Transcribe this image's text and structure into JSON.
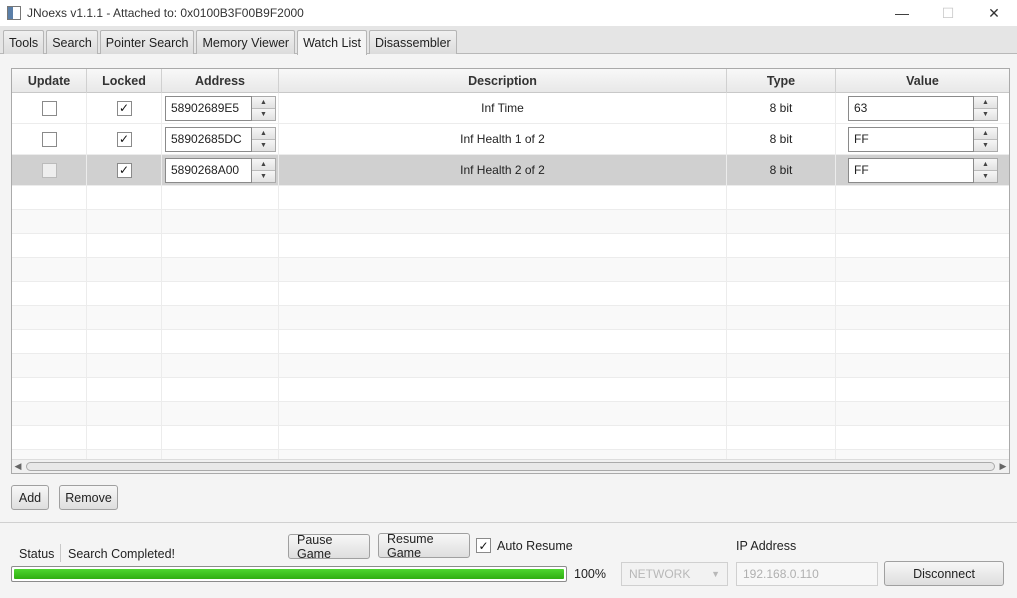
{
  "window": {
    "title": "JNoexs v1.1.1 - Attached to: 0x0100B3F00B9F2000",
    "minimize_glyph": "—",
    "maximize_glyph": "☐",
    "close_glyph": "✕"
  },
  "tabs": [
    {
      "label": "Tools"
    },
    {
      "label": "Search"
    },
    {
      "label": "Pointer Search"
    },
    {
      "label": "Memory Viewer"
    },
    {
      "label": "Watch List",
      "active": true
    },
    {
      "label": "Disassembler"
    }
  ],
  "table": {
    "headers": {
      "update": "Update",
      "locked": "Locked",
      "address": "Address",
      "description": "Description",
      "type": "Type",
      "value": "Value"
    },
    "rows": [
      {
        "update": false,
        "locked": true,
        "address": "58902689E5",
        "description": "Inf Time",
        "type": "8 bit",
        "value": "63",
        "selected": false
      },
      {
        "update": false,
        "locked": true,
        "address": "58902685DC",
        "description": "Inf Health 1 of 2",
        "type": "8 bit",
        "value": "FF",
        "selected": false
      },
      {
        "update": false,
        "locked": true,
        "address": "5890268A00",
        "description": "Inf Health 2 of 2",
        "type": "8 bit",
        "value": "FF",
        "selected": true
      }
    ]
  },
  "buttons": {
    "add": "Add",
    "remove": "Remove",
    "pause_game": "Pause Game",
    "resume_game": "Resume Game",
    "disconnect": "Disconnect"
  },
  "status": {
    "label": "Status",
    "text": "Search Completed!",
    "progress_percent": 100,
    "progress_text": "100%"
  },
  "auto_resume": {
    "label": "Auto Resume",
    "checked": true
  },
  "connection": {
    "mode_value": "NETWORK",
    "ip_label": "IP Address",
    "ip_value": "192.168.0.110"
  },
  "colors": {
    "progress_green": "#2fae12",
    "selected_row": "#d0d0d0"
  }
}
